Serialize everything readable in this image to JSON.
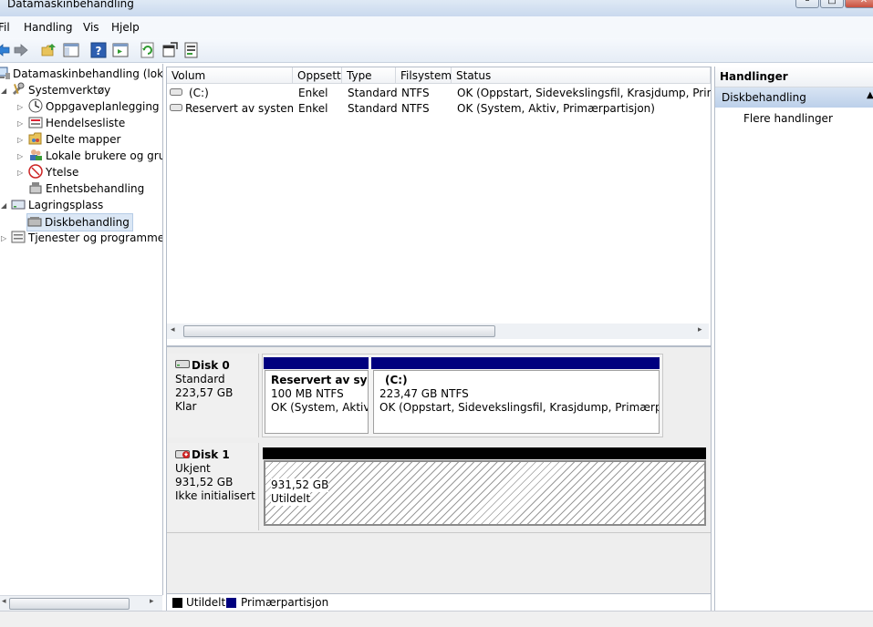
{
  "window": {
    "title": "Datamaskinbehandling"
  },
  "menu": {
    "items": [
      "Fil",
      "Handling",
      "Vis",
      "Hjelp"
    ]
  },
  "toolbar": {
    "icons": [
      "back-arrow-icon",
      "forward-arrow-icon",
      "up-folder-icon",
      "show-hide-tree-icon",
      "help-icon",
      "show-hide-action-pane-icon",
      "refresh-icon",
      "properties-icon",
      "export-list-icon"
    ]
  },
  "tree": {
    "root": "Datamaskinbehandling (lokal)",
    "systemverktoy": "Systemverktøy",
    "oppgaveplanlegging": "Oppgaveplanlegging",
    "hendelsesliste": "Hendelsesliste",
    "delte_mapper": "Delte mapper",
    "lokale_brukere": "Lokale brukere og grupper",
    "ytelse": "Ytelse",
    "enhetsbehandling": "Enhetsbehandling",
    "lagringsplass": "Lagringsplass",
    "diskbehandling": "Diskbehandling",
    "tjenester": "Tjenester og programmer"
  },
  "volumes": {
    "columns": [
      "Volum",
      "Oppsett",
      "Type",
      "Filsystem",
      "Status"
    ],
    "rows": [
      {
        "volum": "(C:)",
        "oppsett": "Enkel",
        "type": "Standard",
        "filsystem": "NTFS",
        "status": "OK (Oppstart, Sidevekslingsfil, Krasjdump, Primærpartisjon)"
      },
      {
        "volum": "Reservert av systemet",
        "oppsett": "Enkel",
        "type": "Standard",
        "filsystem": "NTFS",
        "status": "OK (System, Aktiv, Primærpartisjon)"
      }
    ]
  },
  "disks": [
    {
      "name": "Disk 0",
      "type": "Standard",
      "size": "223,57 GB",
      "state": "Klar",
      "partitions": [
        {
          "label": "Reservert av systemet",
          "size": "100 MB NTFS",
          "status": "OK (System, Aktiv, Primærpartisjon)"
        },
        {
          "label": "(C:)",
          "size": "223,47 GB NTFS",
          "status": "OK (Oppstart, Sidevekslingsfil, Krasjdump, Primærpartisjon)"
        }
      ]
    },
    {
      "name": "Disk 1",
      "type": "Ukjent",
      "size": "931,52 GB",
      "state": "Ikke initialisert",
      "partitions": [
        {
          "label": "",
          "size": "931,52 GB",
          "status": "Utildelt"
        }
      ]
    }
  ],
  "legend": {
    "unallocated": "Utildelt",
    "primary": "Primærpartisjon"
  },
  "actions": {
    "header": "Handlinger",
    "section": "Diskbehandling",
    "more": "Flere handlinger"
  },
  "colors": {
    "primary_partition": "#00007f",
    "unallocated": "#000000",
    "selection": "#dbe7f5"
  }
}
